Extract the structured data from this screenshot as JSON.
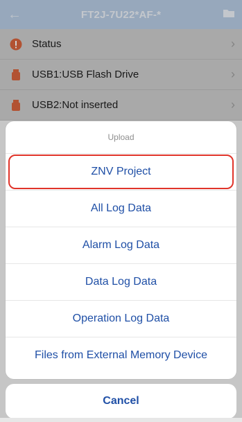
{
  "navbar": {
    "title": "FT2J-7U22*AF-*",
    "back_icon": "arrow-left-icon",
    "folder_icon": "folder-icon",
    "color": "#1f4fa6"
  },
  "list": {
    "items": [
      {
        "label": "Status",
        "icon": "alert-circle-icon",
        "icon_color": "#e0342a"
      },
      {
        "label": "USB1:USB Flash Drive",
        "icon": "usb-drive-icon",
        "icon_color": "#e06a2a"
      },
      {
        "label": "USB2:Not inserted",
        "icon": "usb-drive-icon",
        "icon_color": "#e06a2a"
      }
    ],
    "chevron_icon": "chevron-right-icon"
  },
  "sheet": {
    "header": "Upload",
    "items": [
      {
        "label": "ZNV Project"
      },
      {
        "label": "All Log Data"
      },
      {
        "label": "Alarm Log Data"
      },
      {
        "label": "Data Log Data"
      },
      {
        "label": "Operation Log Data"
      },
      {
        "label": "Files from External Memory Device"
      }
    ],
    "highlight_color": "#e0342a"
  },
  "cancel": {
    "label": "Cancel"
  }
}
